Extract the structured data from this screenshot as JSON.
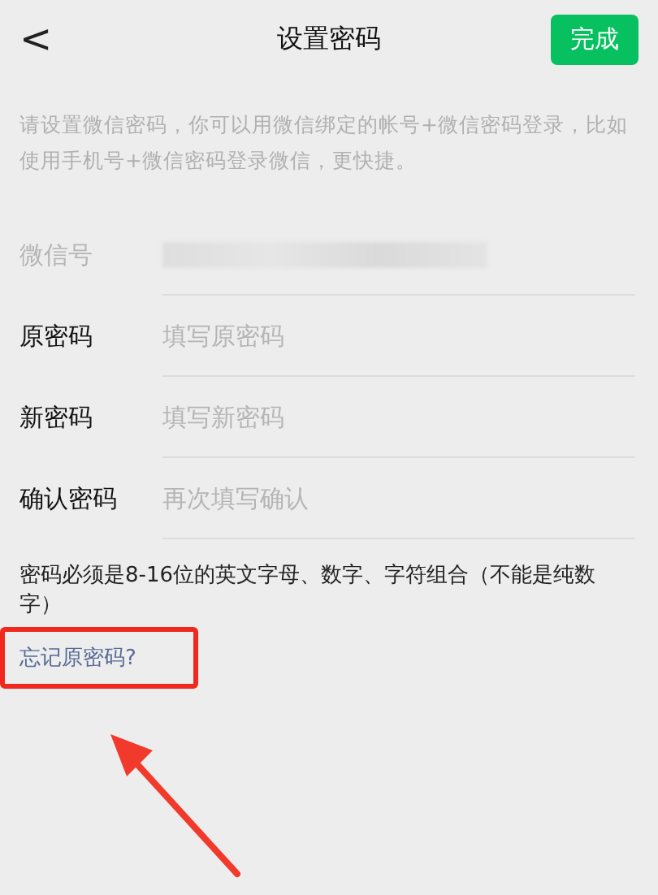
{
  "header": {
    "back": "<",
    "title": "设置密码",
    "done_button": "完成"
  },
  "intro": "请设置微信密码，你可以用微信绑定的帐号+微信密码登录，比如使用手机号+微信密码登录微信，更快捷。",
  "fields": [
    {
      "kind": "readonly",
      "label": "微信号"
    },
    {
      "kind": "input",
      "label": "原密码",
      "placeholder": "填写原密码"
    },
    {
      "kind": "input",
      "label": "新密码",
      "placeholder": "填写新密码"
    },
    {
      "kind": "input",
      "label": "确认密码",
      "placeholder": "再次填写确认"
    }
  ],
  "rule_note": "密码必须是8-16位的英文字母、数字、字符组合（不能是纯数字）",
  "forgot_link": "忘记原密码?"
}
